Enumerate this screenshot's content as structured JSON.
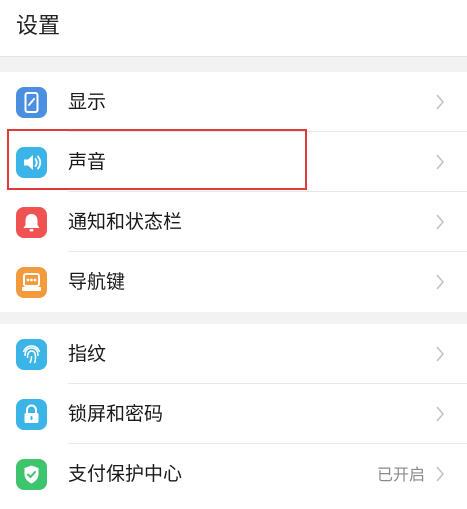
{
  "header": {
    "title": "设置"
  },
  "groups": [
    {
      "items": [
        {
          "label": "显示",
          "icon": "display-icon",
          "color": "#4a8fe0"
        },
        {
          "label": "声音",
          "icon": "sound-icon",
          "color": "#3bb5e8"
        },
        {
          "label": "通知和状态栏",
          "icon": "notification-bell-icon",
          "color": "#f05252"
        },
        {
          "label": "导航键",
          "icon": "navigation-key-icon",
          "color": "#f39a3d"
        }
      ]
    },
    {
      "items": [
        {
          "label": "指纹",
          "icon": "fingerprint-icon",
          "color": "#3bb5e8"
        },
        {
          "label": "锁屏和密码",
          "icon": "lock-icon",
          "color": "#3bb5e8"
        },
        {
          "label": "支付保护中心",
          "icon": "shield-check-icon",
          "color": "#3ec46d",
          "status": "已开启"
        }
      ]
    }
  ],
  "highlight": {
    "target": "声音",
    "color": "#e03a3a"
  }
}
